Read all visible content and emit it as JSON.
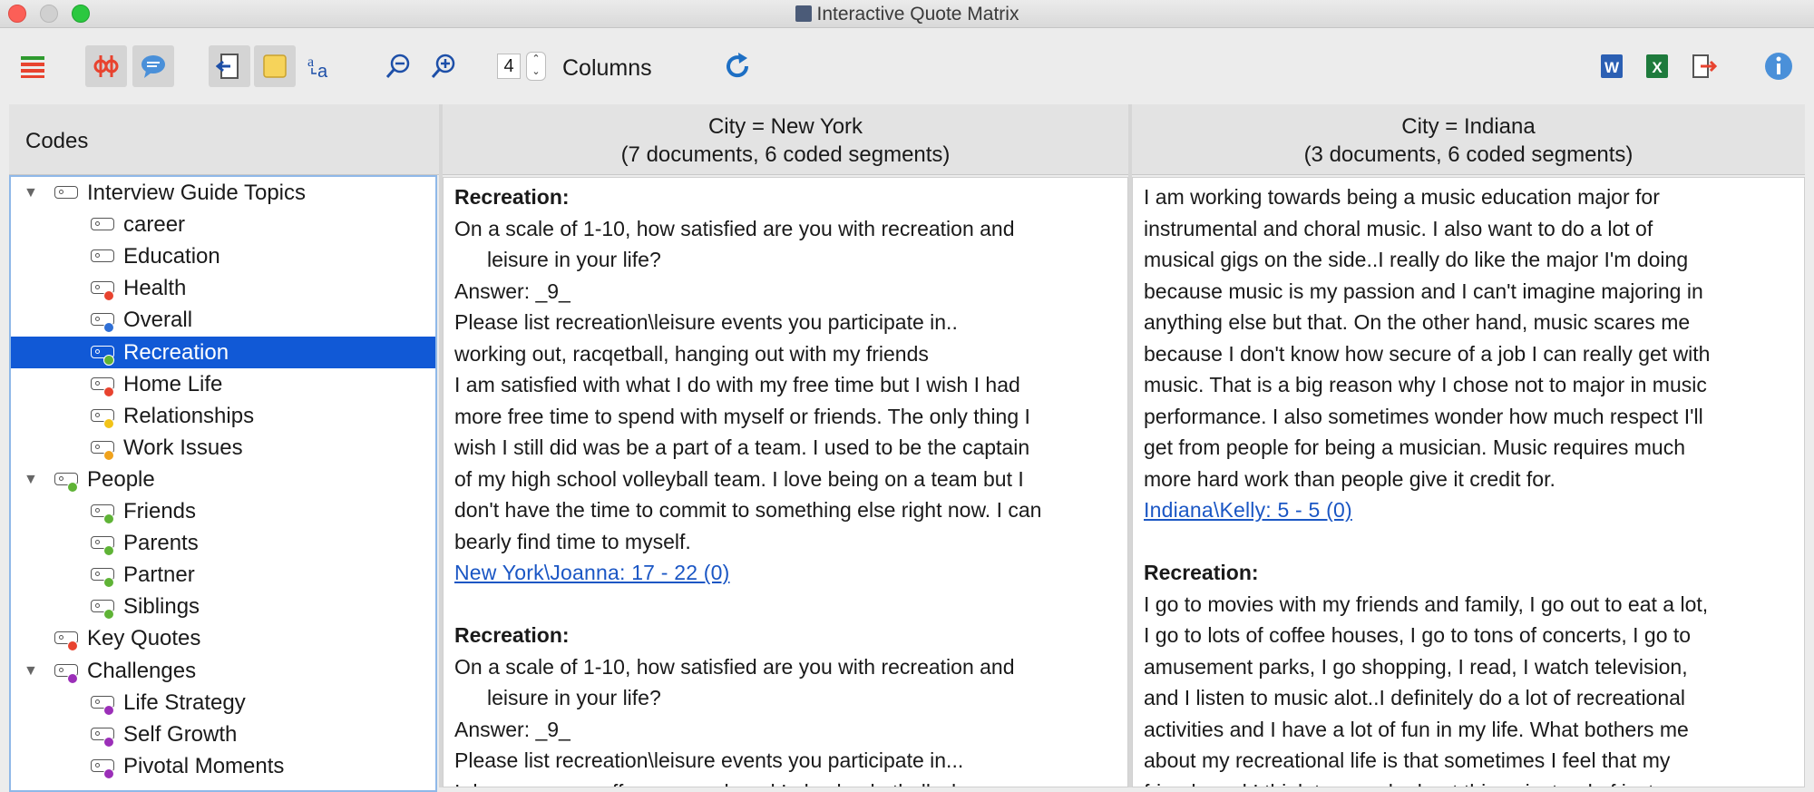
{
  "window": {
    "title": "Interactive Quote Matrix"
  },
  "toolbar": {
    "columns_value": "4",
    "columns_label": "Columns",
    "icons": [
      "menu-icon",
      "activate-codes-icon",
      "memo-bubble-icon",
      "export-document-icon",
      "memo-note-icon",
      "text-format-icon",
      "zoom-out-icon",
      "zoom-in-icon",
      "refresh-icon",
      "word-export-icon",
      "excel-export-icon",
      "export-arrow-icon",
      "info-icon"
    ]
  },
  "codes_panel": {
    "title": "Codes",
    "items": [
      {
        "label": "Interview Guide Topics",
        "level": 0,
        "expandable": true,
        "dot": null
      },
      {
        "label": "career",
        "level": 1,
        "dot": null
      },
      {
        "label": "Education",
        "level": 1,
        "dot": null
      },
      {
        "label": "Health",
        "level": 1,
        "dot": "#e8432f"
      },
      {
        "label": "Overall",
        "level": 1,
        "dot": "#2f6fd6"
      },
      {
        "label": "Recreation",
        "level": 1,
        "dot": "#5fb336",
        "selected": true
      },
      {
        "label": "Home Life",
        "level": 1,
        "dot": "#e8432f"
      },
      {
        "label": "Relationships",
        "level": 1,
        "dot": "#f2c318"
      },
      {
        "label": "Work Issues",
        "level": 1,
        "dot": "#f0a21c"
      },
      {
        "label": "People",
        "level": 0,
        "expandable": true,
        "dot": "#5fb336"
      },
      {
        "label": "Friends",
        "level": 1,
        "dot": "#5fb336"
      },
      {
        "label": "Parents",
        "level": 1,
        "dot": "#5fb336"
      },
      {
        "label": "Partner",
        "level": 1,
        "dot": "#5fb336"
      },
      {
        "label": "Siblings",
        "level": 1,
        "dot": "#5fb336"
      },
      {
        "label": "Key Quotes",
        "level": 0,
        "dot": "#e8432f"
      },
      {
        "label": "Challenges",
        "level": 0,
        "expandable": true,
        "dot": "#9b2fb8"
      },
      {
        "label": "Life Strategy",
        "level": 1,
        "dot": "#9b2fb8"
      },
      {
        "label": "Self Growth",
        "level": 1,
        "dot": "#9b2fb8"
      },
      {
        "label": "Pivotal Moments",
        "level": 1,
        "dot": "#9b2fb8"
      }
    ]
  },
  "columns": [
    {
      "header_line1": "City = New York",
      "header_line2": "(7 documents, 6 coded segments)",
      "seg1": {
        "head": "Recreation:",
        "q1": "On a scale of 1-10, how satisfied are you with recreation and",
        "q1b": "leisure in your life?",
        "answer": "Answer: _9_",
        "q2": "Please list recreation\\leisure events you participate in..",
        "a2": "working out, racqetball, hanging out with my friends",
        "t1": "I am satisfied with what I do with my free time but I wish I had",
        "t2": "more free time to spend with myself or friends.  The only thing I",
        "t3": "wish I still did was be a part of a team.  I used to be the captain",
        "t4": "of my high school volleyball team.  I love being on a team but I",
        "t5": "don't have the time to commit to something else right now.  I can",
        "t6": "bearly find time to myself.",
        "source": "New York\\Joanna: 17 - 22  (0)"
      },
      "seg2": {
        "head": "Recreation:",
        "q1": "On a scale of 1-10, how satisfied are you with recreation and",
        "q1b": "leisure in your life?",
        "answer": "Answer: _9_",
        "q2": "Please list recreation\\leisure events you participate in...",
        "t1": "I dance my ass off every week and I play basketball whenever"
      }
    },
    {
      "header_line1": "City = Indiana",
      "header_line2": "(3 documents, 6 coded segments)",
      "seg1": {
        "t1": "I am working towards being a music education major for",
        "t2": "instrumental and choral music.  I also want to do a lot of",
        "t3": "musical gigs on the side..I really do like the major I'm doing",
        "t4": "because music is my passion and I can't imagine majoring in",
        "t5": "anything else but that.  On the other hand, music scares me",
        "t6": "because I don't know how secure of a job I can really get with",
        "t7": "music.  That is a big reason why I chose not to major in music",
        "t8": "performance.  I also sometimes wonder how much respect I'll",
        "t9": "get from people for being a musician.  Music requires much",
        "t10": "more hard work than people give it credit for.",
        "source": "Indiana\\Kelly: 5 - 5  (0)"
      },
      "seg2": {
        "head": "Recreation:",
        "t1": "I go to movies with my friends and family, I go out to eat a lot,",
        "t2": "I go to lots of coffee houses, I go to tons of concerts, I go to",
        "t3": "amusement parks, I go shopping, I read, I watch television,",
        "t4": "and I listen to music alot..I definitely do a lot of recreational",
        "t5": "activities and I have a lot of fun in my life.  What bothers me",
        "t6": "about my recreational life is that sometimes I feel that my",
        "t7": "friends and I think too much about things instead of just"
      }
    }
  ],
  "colors": {
    "selection": "#1159d6",
    "link": "#1a56c4",
    "accent_red": "#e8432f"
  }
}
